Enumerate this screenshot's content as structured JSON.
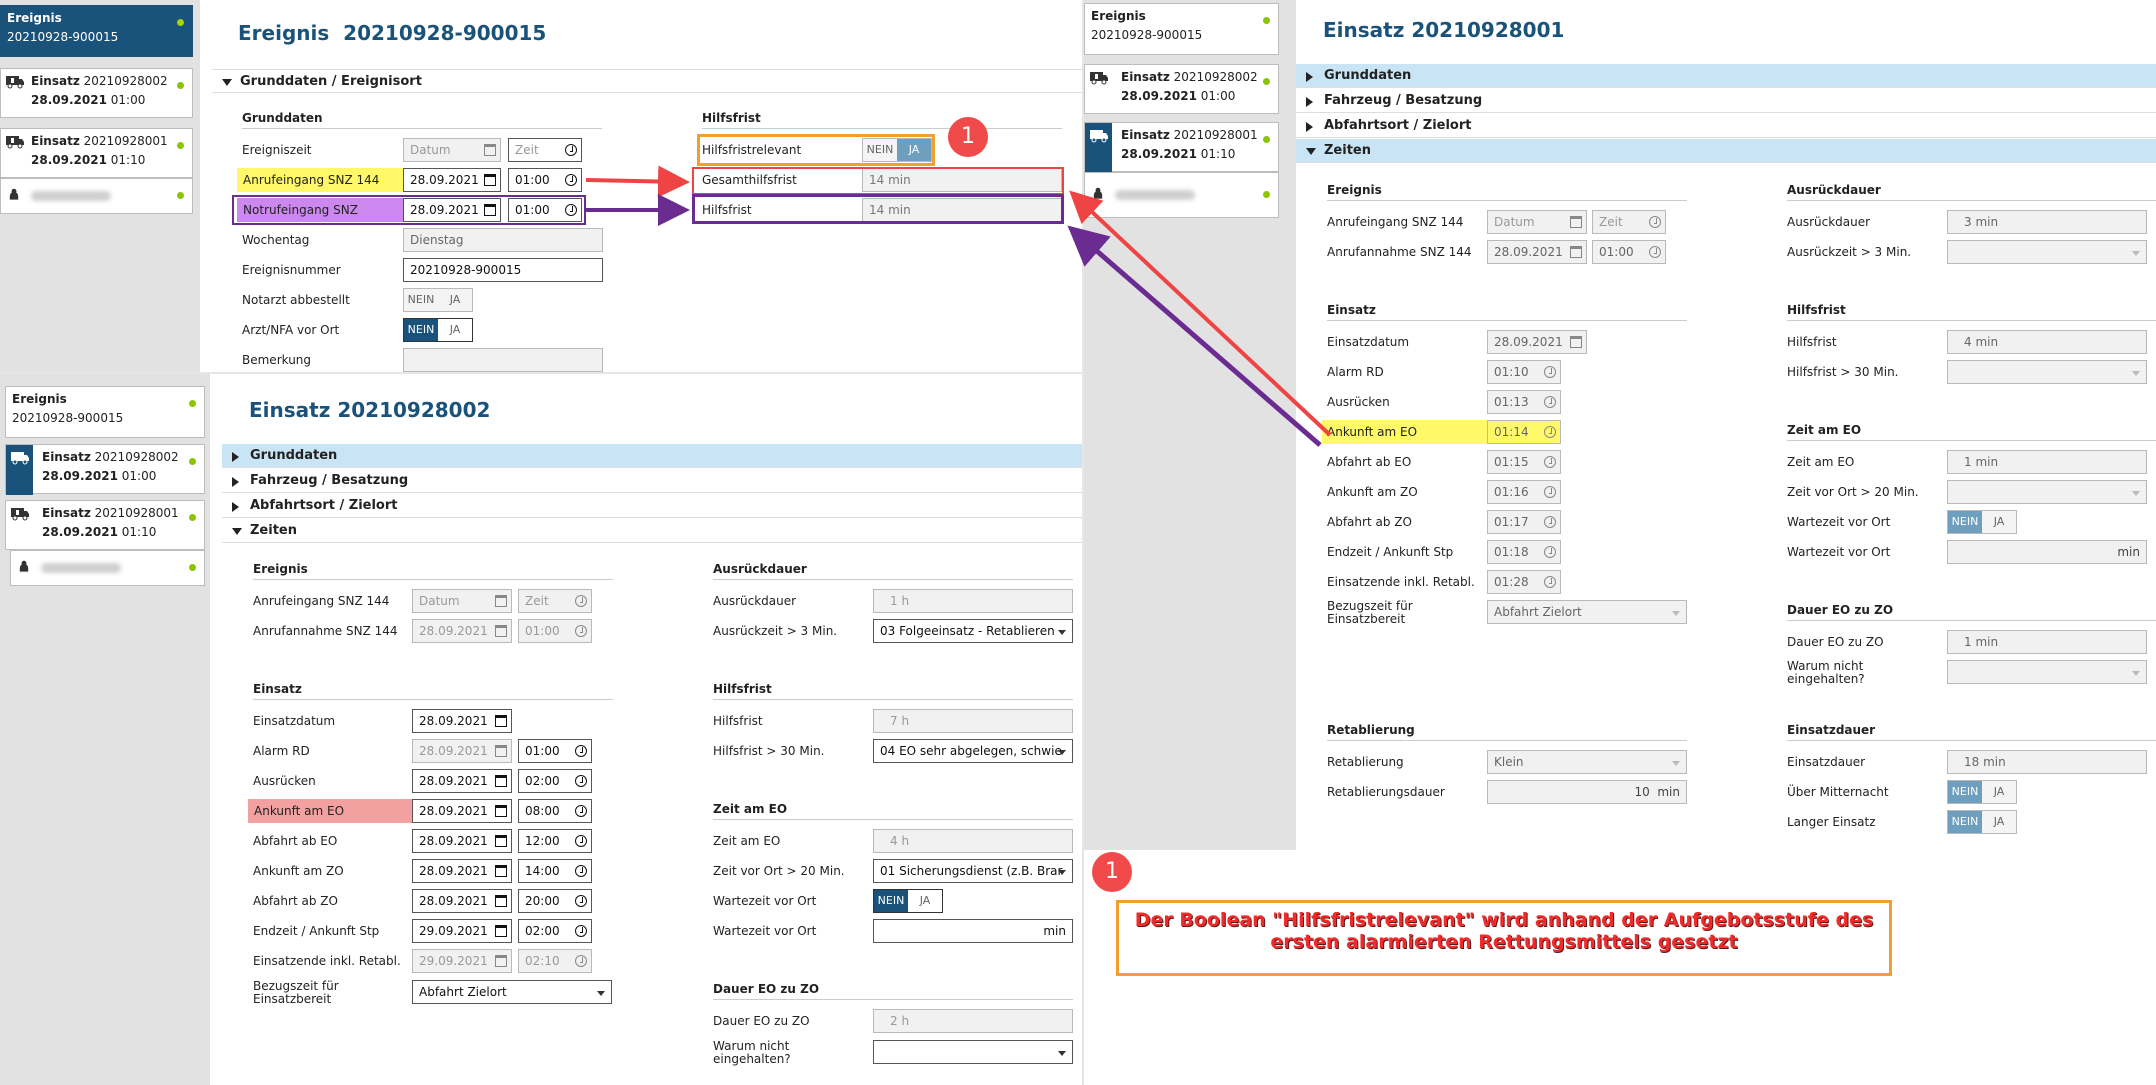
{
  "top": {
    "nav": [
      {
        "line1": "Ereignis",
        "line2": "20210928-900015",
        "selected": true
      },
      {
        "title": "Einsatz",
        "num": "20210928002",
        "date": "28.09.2021",
        "time": "01:00"
      },
      {
        "title": "Einsatz",
        "num": "20210928001",
        "date": "28.09.2021",
        "time": "01:10"
      },
      {
        "person": "redacted"
      }
    ],
    "title": "Ereignis  20210928-900015",
    "section": "Grunddaten / Ereignisort",
    "left_group": "Grunddaten",
    "right_group": "Hilfsfrist",
    "fields": {
      "ereigniszeit": {
        "label": "Ereigniszeit",
        "date": "Datum",
        "time": "Zeit"
      },
      "anruf": {
        "label": "Anrufeingang SNZ 144",
        "date": "28.09.2021",
        "time": "01:00"
      },
      "notruf": {
        "label": "Notrufeingang SNZ",
        "date": "28.09.2021",
        "time": "01:00"
      },
      "wochentag": {
        "label": "Wochentag",
        "value": "Dienstag"
      },
      "ereignisnummer": {
        "label": "Ereignisnummer",
        "value": "20210928-900015"
      },
      "notarzt": {
        "label": "Notarzt abbestellt",
        "nein": "NEIN",
        "ja": "JA"
      },
      "arzt": {
        "label": "Arzt/NFA vor Ort",
        "nein": "NEIN",
        "ja": "JA"
      },
      "bemerkung": {
        "label": "Bemerkung"
      }
    },
    "hilfsfrist": {
      "relevant": {
        "label": "Hilfsfristrelevant",
        "nein": "NEIN",
        "ja": "JA"
      },
      "gesamt": {
        "label": "Gesamthilfsfrist",
        "value": "14 min"
      },
      "hf": {
        "label": "Hilfsfrist",
        "value": "14 min"
      }
    }
  },
  "bottom": {
    "nav": [
      {
        "line1": "Ereignis",
        "line2": "20210928-900015"
      },
      {
        "title": "Einsatz",
        "num": "20210928002",
        "date": "28.09.2021",
        "time": "01:00",
        "selected": true
      },
      {
        "title": "Einsatz",
        "num": "20210928001",
        "date": "28.09.2021",
        "time": "01:10"
      },
      {
        "person": "redacted"
      }
    ],
    "title": "Einsatz 20210928002",
    "sections": [
      "Grunddaten",
      "Fahrzeug / Besatzung",
      "Abfahrtsort / Zielort",
      "Zeiten"
    ],
    "g_ereignis": "Ereignis",
    "g_einsatz": "Einsatz",
    "g_ausrueck": "Ausrückdauer",
    "g_hilfsfrist": "Hilfsfrist",
    "g_zeitameo": "Zeit am EO",
    "g_dauereo": "Dauer EO zu ZO",
    "rows": {
      "anrufeingang": {
        "label": "Anrufeingang SNZ 144",
        "date": "Datum",
        "time": "Zeit"
      },
      "anrufannahme": {
        "label": "Anrufannahme SNZ 144",
        "date": "28.09.2021",
        "time": "01:00"
      },
      "einsatzdatum": {
        "label": "Einsatzdatum",
        "date": "28.09.2021"
      },
      "alarm": {
        "label": "Alarm RD",
        "date": "28.09.2021",
        "time": "01:00"
      },
      "ausruecken": {
        "label": "Ausrücken",
        "date": "28.09.2021",
        "time": "02:00"
      },
      "ankunfteo": {
        "label": "Ankunft am EO",
        "date": "28.09.2021",
        "time": "08:00"
      },
      "abfahrteo": {
        "label": "Abfahrt ab EO",
        "date": "28.09.2021",
        "time": "12:00"
      },
      "ankunftzo": {
        "label": "Ankunft am ZO",
        "date": "28.09.2021",
        "time": "14:00"
      },
      "abfahrtzo": {
        "label": "Abfahrt ab ZO",
        "date": "28.09.2021",
        "time": "20:00"
      },
      "endzeit": {
        "label": "Endzeit / Ankunft Stp",
        "date": "29.09.2021",
        "time": "02:00"
      },
      "einsatzende": {
        "label": "Einsatzende inkl. Retabl.",
        "date": "29.09.2021",
        "time": "02:10"
      },
      "bezugszeit": {
        "label": "Bezugszeit für Einsatzbereit",
        "value": "Abfahrt Zielort"
      },
      "ausrueckdauer": {
        "label": "Ausrückdauer",
        "value": "1 h"
      },
      "ausrueckzeit": {
        "label": "Ausrückzeit > 3 Min.",
        "value": "03 Folgeeinsatz - Retablieren"
      },
      "hilfsfrist": {
        "label": "Hilfsfrist",
        "value": "7 h"
      },
      "hilfsfrist30": {
        "label": "Hilfsfrist > 30 Min.",
        "value": "04 EO sehr abgelegen, schwie"
      },
      "zeitameo": {
        "label": "Zeit am EO",
        "value": "4 h"
      },
      "zeitvorort": {
        "label": "Zeit vor Ort > 20 Min.",
        "value": "01 Sicherungsdienst (z.B. Brar"
      },
      "wartezeit1": {
        "label": "Wartezeit vor Ort",
        "nein": "NEIN",
        "ja": "JA"
      },
      "wartezeit2": {
        "label": "Wartezeit vor Ort",
        "unit": "min"
      },
      "dauereozo": {
        "label": "Dauer EO zu ZO",
        "value": "2 h"
      },
      "warum": {
        "label": "Warum nicht eingehalten?"
      }
    }
  },
  "right": {
    "nav": [
      {
        "line1": "Ereignis",
        "line2": "20210928-900015"
      },
      {
        "title": "Einsatz",
        "num": "20210928002",
        "date": "28.09.2021",
        "time": "01:00"
      },
      {
        "title": "Einsatz",
        "num": "20210928001",
        "date": "28.09.2021",
        "time": "01:10",
        "selected": true
      },
      {
        "person": "redacted"
      }
    ],
    "title": "Einsatz 20210928001",
    "sections": [
      "Grunddaten",
      "Fahrzeug / Besatzung",
      "Abfahrtsort / Zielort",
      "Zeiten"
    ],
    "g_ereignis": "Ereignis",
    "g_einsatz": "Einsatz",
    "g_retab": "Retablierung",
    "g_ausrueck": "Ausrückdauer",
    "g_hilfsfrist": "Hilfsfrist",
    "g_zeitameo": "Zeit am EO",
    "g_dauereo": "Dauer EO zu ZO",
    "g_einsatzdauer": "Einsatzdauer",
    "rows": {
      "anrufeingang": {
        "label": "Anrufeingang SNZ 144",
        "date": "Datum",
        "time": "Zeit"
      },
      "anrufannahme": {
        "label": "Anrufannahme SNZ 144",
        "date": "28.09.2021",
        "time": "01:00"
      },
      "einsatzdatum": {
        "label": "Einsatzdatum",
        "date": "28.09.2021"
      },
      "alarm": {
        "label": "Alarm RD",
        "time": "01:10"
      },
      "ausruecken": {
        "label": "Ausrücken",
        "time": "01:13"
      },
      "ankunfteo": {
        "label": "Ankunft am EO",
        "time": "01:14"
      },
      "abfahrteo": {
        "label": "Abfahrt ab EO",
        "time": "01:15"
      },
      "ankunftzo": {
        "label": "Ankunft am ZO",
        "time": "01:16"
      },
      "abfahrtzo": {
        "label": "Abfahrt ab ZO",
        "time": "01:17"
      },
      "endzeit": {
        "label": "Endzeit / Ankunft Stp",
        "time": "01:18"
      },
      "einsatzende": {
        "label": "Einsatzende inkl. Retabl.",
        "time": "01:28"
      },
      "bezugszeit": {
        "label": "Bezugszeit für Einsatzbereit",
        "value": "Abfahrt Zielort"
      },
      "retablierung": {
        "label": "Retablierung",
        "value": "Klein"
      },
      "retabdauer": {
        "label": "Retablierungsdauer",
        "value": "10  min"
      },
      "ausrueckdauer": {
        "label": "Ausrückdauer",
        "value": "3 min"
      },
      "ausrueckzeit": {
        "label": "Ausrückzeit > 3 Min."
      },
      "hilfsfrist": {
        "label": "Hilfsfrist",
        "value": "4 min"
      },
      "hilfsfrist30": {
        "label": "Hilfsfrist > 30 Min."
      },
      "zeitameo": {
        "label": "Zeit am EO",
        "value": "1 min"
      },
      "zeitvorort": {
        "label": "Zeit vor Ort > 20 Min."
      },
      "wartezeit1": {
        "label": "Wartezeit vor Ort",
        "nein": "NEIN",
        "ja": "JA"
      },
      "wartezeit2": {
        "label": "Wartezeit vor Ort",
        "unit": "min"
      },
      "dauereozo": {
        "label": "Dauer EO zu ZO",
        "value": "1 min"
      },
      "warum": {
        "label": "Warum nicht eingehalten?"
      },
      "einsatzdauer": {
        "label": "Einsatzdauer",
        "value": "18 min"
      },
      "mitternacht": {
        "label": "Über Mitternacht",
        "nein": "NEIN",
        "ja": "JA"
      },
      "langer": {
        "label": "Langer Einsatz",
        "nein": "NEIN",
        "ja": "JA"
      }
    }
  },
  "annotation": {
    "marker": "1",
    "note": "Der Boolean \"Hilfsfristrelevant\" wird anhand der Aufgebotsstufe des ersten alarmierten Rettungsmittels gesetzt",
    "colors": {
      "red": "#ef4444",
      "purple": "#6b2c91",
      "orange": "#f0a030",
      "yellow": "#fff96a",
      "lilac": "#cc88ee",
      "pink": "#f3a0a0"
    }
  }
}
